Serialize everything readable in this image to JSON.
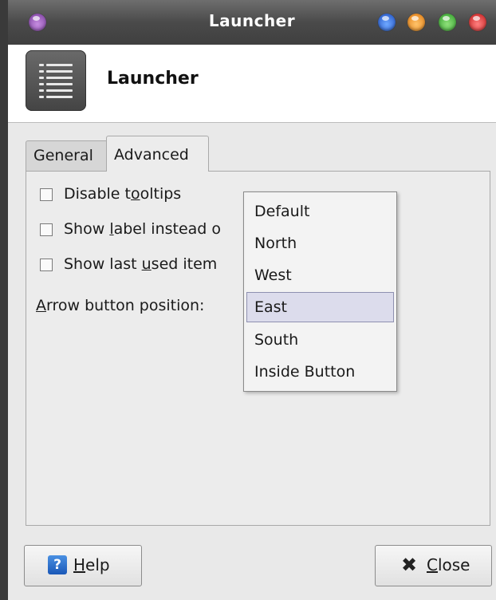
{
  "window": {
    "title": "Launcher"
  },
  "header": {
    "title": "Launcher",
    "icon": "list-icon"
  },
  "tabs": [
    {
      "label": "General",
      "active": false
    },
    {
      "label": "Advanced",
      "active": true
    }
  ],
  "options": [
    {
      "pre": "Disable t",
      "mnemonic": "o",
      "post": "oltips",
      "checked": false
    },
    {
      "pre": "Show ",
      "mnemonic": "l",
      "post": "abel instead o",
      "checked": false
    },
    {
      "pre": "Show last ",
      "mnemonic": "u",
      "post": "sed item",
      "checked": false
    }
  ],
  "arrow_position": {
    "label_mnemonic": "A",
    "label_rest": "rrow button position:",
    "selected": "East",
    "options": [
      "Default",
      "North",
      "West",
      "East",
      "South",
      "Inside Button"
    ]
  },
  "buttons": {
    "help": {
      "mnemonic": "H",
      "rest": "elp",
      "icon": "help-icon"
    },
    "close": {
      "mnemonic": "C",
      "rest": "lose",
      "icon": "close-icon"
    }
  },
  "colors": {
    "titlebar": "#4a4a4a",
    "selection": "#dcdcec",
    "window_bg": "#e9e9e9"
  }
}
